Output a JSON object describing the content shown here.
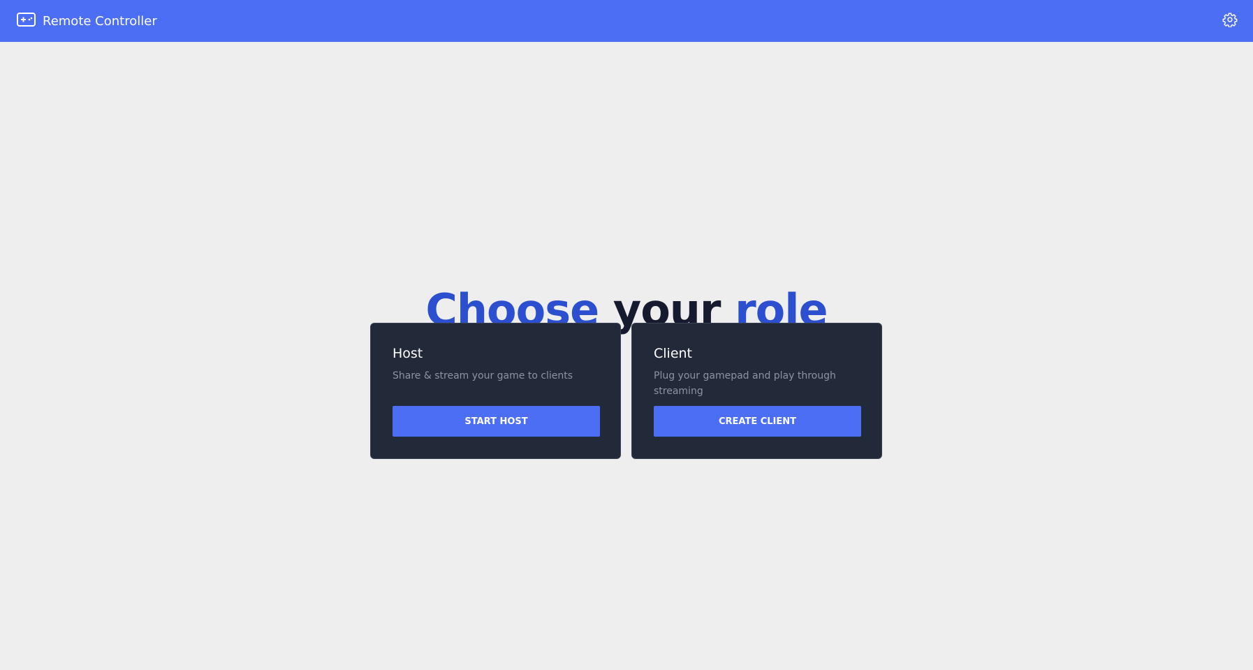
{
  "app": {
    "title": "Remote Controller",
    "logo_icon": "gamepad-icon",
    "settings_icon": "gear-icon"
  },
  "main": {
    "headline": {
      "word1": "Choose",
      "word2": "your",
      "word3": "role"
    },
    "cards": [
      {
        "title": "Host",
        "description": "Share & stream your game to clients",
        "button_label": "START HOST"
      },
      {
        "title": "Client",
        "description": "Plug your gamepad and play through streaming",
        "button_label": "CREATE CLIENT"
      }
    ]
  },
  "colors": {
    "accent": "#4c6ef5",
    "background": "#eeeeee",
    "card": "#222a3a",
    "headline_blue": "#2c4fcf",
    "headline_dark": "#161a2e"
  }
}
